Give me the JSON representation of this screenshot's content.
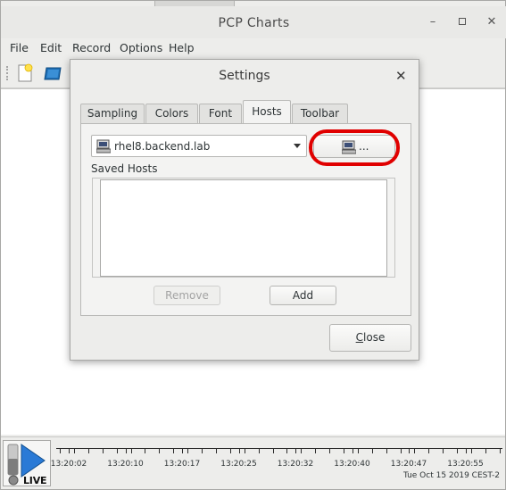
{
  "window": {
    "title": "PCP Charts",
    "controls": {
      "minimize": "–",
      "maximize": "",
      "close": "✕"
    }
  },
  "menubar": [
    {
      "label": "File"
    },
    {
      "label": "Edit"
    },
    {
      "label": "Record"
    },
    {
      "label": "Options"
    },
    {
      "label": "Help"
    }
  ],
  "toolbar": {
    "icons": [
      "new-chart-icon",
      "open-view-icon"
    ]
  },
  "timebar": {
    "live_label": "LIVE",
    "ticks": [
      "13:20:02",
      "13:20:10",
      "13:20:17",
      "13:20:25",
      "13:20:32",
      "13:20:40",
      "13:20:47",
      "13:20:55"
    ],
    "date": "Tue Oct 15 2019 CEST-2"
  },
  "dialog": {
    "title": "Settings",
    "close_glyph": "✕",
    "tabs": [
      {
        "label": "Sampling",
        "active": false
      },
      {
        "label": "Colors",
        "active": false
      },
      {
        "label": "Font",
        "active": false
      },
      {
        "label": "Hosts",
        "active": true
      },
      {
        "label": "Toolbar",
        "active": false
      }
    ],
    "hosts": {
      "selected_host": "rhel8.backend.lab",
      "browse_label": "...",
      "saved_hosts_label": "Saved Hosts",
      "saved_hosts": [],
      "remove_label": "Remove",
      "add_label": "Add"
    },
    "close_button": {
      "mnemonic": "C",
      "rest": "lose"
    }
  },
  "colors": {
    "highlight": "#e00000",
    "accent_blue": "#1f6fb5"
  }
}
